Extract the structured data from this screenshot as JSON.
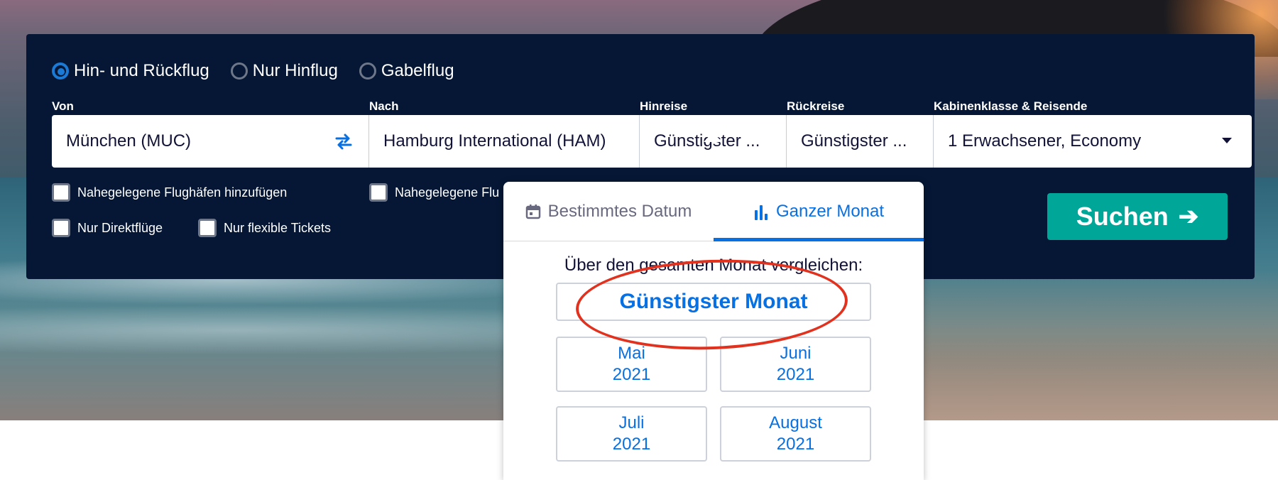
{
  "trip_types": [
    {
      "label": "Hin- und Rückflug",
      "checked": true
    },
    {
      "label": "Nur Hinflug",
      "checked": false
    },
    {
      "label": "Gabelflug",
      "checked": false
    }
  ],
  "labels": {
    "from": "Von",
    "to": "Nach",
    "depart": "Hinreise",
    "return": "Rückreise",
    "cabin": "Kabinenklasse & Reisende"
  },
  "fields": {
    "from": "München (MUC)",
    "to": "Hamburg International (HAM)",
    "depart": "Günstigster ...",
    "return": "Günstigster ...",
    "cabin": "1 Erwachsener, Economy"
  },
  "checkboxes": {
    "nearby_from": "Nahegelegene Flughäfen hinzufügen",
    "nearby_to": "Nahegelegene Flu",
    "direct": "Nur Direktflüge",
    "flexible": "Nur flexible Tickets"
  },
  "search_button": {
    "label": "Suchen",
    "arrow": "➔"
  },
  "popover": {
    "tabs": [
      {
        "label": "Bestimmtes Datum",
        "icon": "calendar-icon",
        "active": false
      },
      {
        "label": "Ganzer Monat",
        "icon": "bar-chart-icon",
        "active": true
      }
    ],
    "compare_text": "Über den gesamten Monat vergleichen:",
    "cheapest_month": "Günstigster Monat",
    "months": [
      {
        "month": "Mai",
        "year": "2021"
      },
      {
        "month": "Juni",
        "year": "2021"
      },
      {
        "month": "Juli",
        "year": "2021"
      },
      {
        "month": "August",
        "year": "2021"
      }
    ]
  },
  "colors": {
    "panel_bg": "#051734",
    "accent_blue": "#0770e3",
    "search_green": "#00a698",
    "highlight_red": "#e0321e"
  }
}
